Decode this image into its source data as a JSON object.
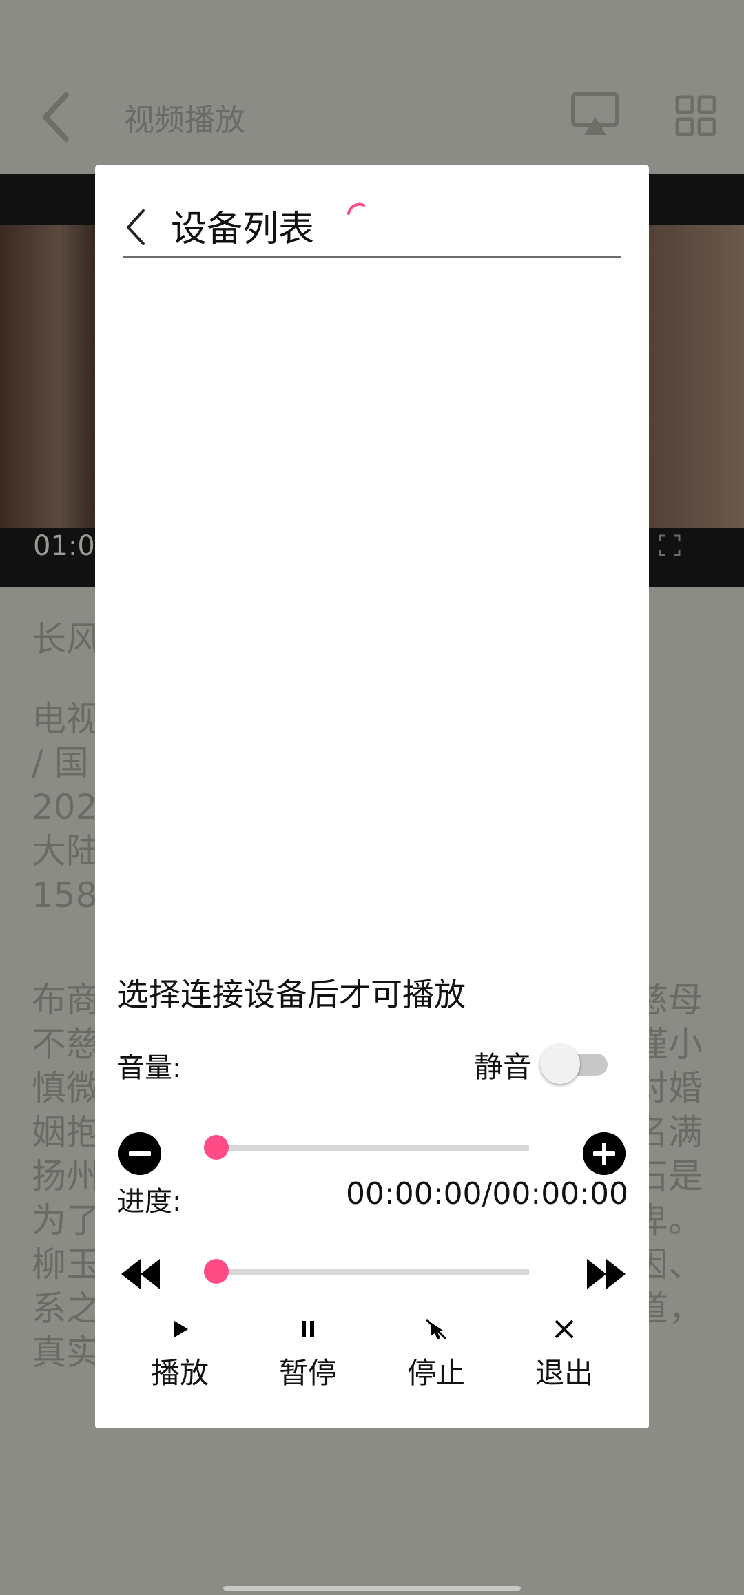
{
  "background": {
    "title": "视频播放",
    "video_time": "01:0",
    "show_title": "长风",
    "info_lines": [
      "电视",
      "/ 国",
      "202",
      "大陆",
      "158"
    ],
    "desc_left": [
      "布商",
      "不慈",
      "慎微",
      "姻抱",
      "扬州",
      "为了",
      "柳玉",
      "系之",
      "真实"
    ],
    "desc_right": [
      "慈母",
      "谨小",
      "对婚",
      "名满",
      "石是",
      "卑。",
      "因、",
      "道，"
    ]
  },
  "dialog": {
    "title": "设备列表",
    "hint": "选择连接设备后才可播放",
    "volume_label": "音量:",
    "mute_label": "静音",
    "mute_on": false,
    "volume_level": 0,
    "progress_label": "进度:",
    "progress_time": "00:00:00/00:00:00",
    "progress_level": 0,
    "controls": {
      "play": "播放",
      "pause": "暂停",
      "stop": "停止",
      "exit": "退出"
    }
  },
  "colors": {
    "accent": "#ff4b86",
    "scrim": "#8c8c86",
    "dialog_bg": "#ffffff"
  },
  "icons": {
    "back": "chevron-left-icon",
    "cast": "cast-icon",
    "grid": "grid-icon",
    "minus": "minus-circle-icon",
    "plus": "plus-circle-icon",
    "rewind": "rewind-icon",
    "forward": "fast-forward-icon",
    "play": "play-icon",
    "pause": "pause-icon",
    "stop": "stop-icon",
    "exit": "close-icon"
  }
}
